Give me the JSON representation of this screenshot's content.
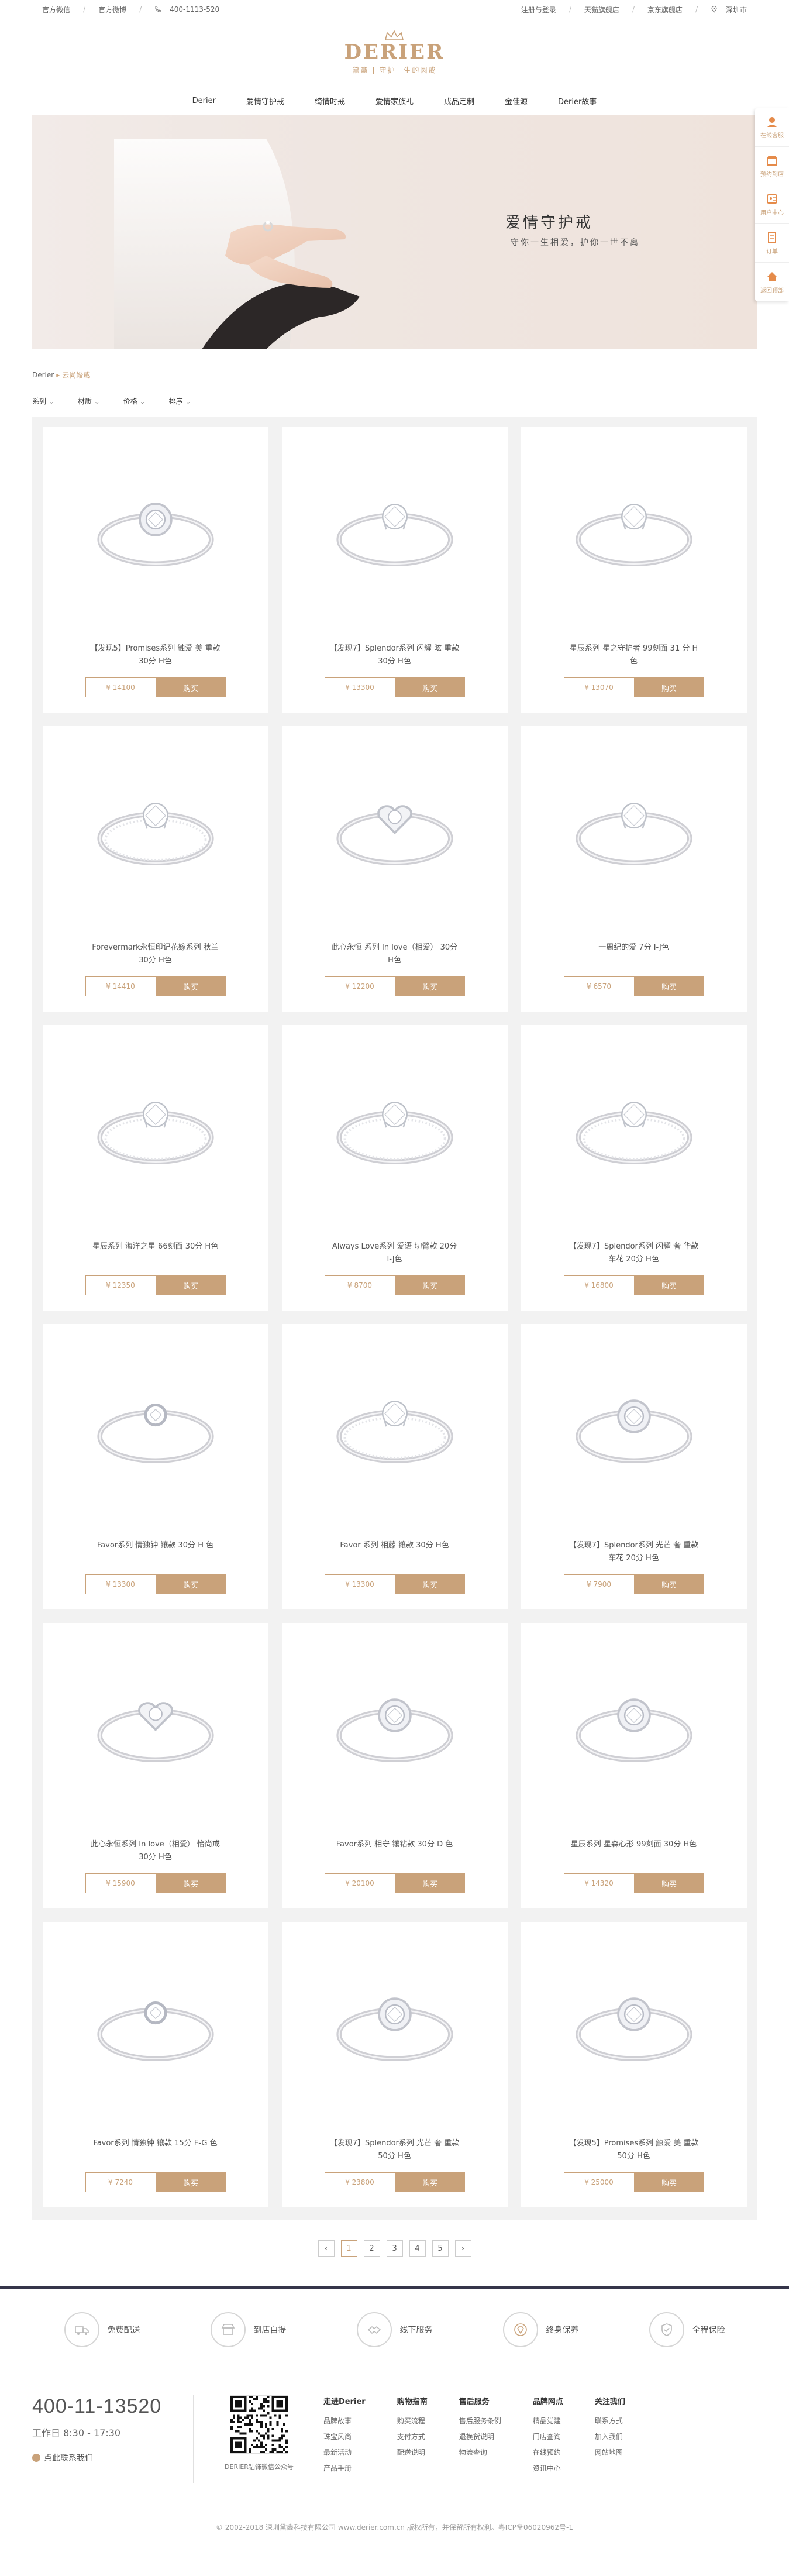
{
  "topbar": {
    "left": [
      "官方微信",
      "官方微博",
      "400-1113-520"
    ],
    "right": [
      "注册与登录",
      "天猫旗舰店",
      "京东旗舰店",
      "深圳市"
    ]
  },
  "logo": {
    "brand": "DERIER",
    "slogan": "黛鑫 | 守护一生的圆戒"
  },
  "nav": [
    "Derier",
    "爱情守护戒",
    "绮情时戒",
    "爱情家族礼",
    "成品定制",
    "金佳源",
    "Derier故事"
  ],
  "banner": {
    "title": "爱情守护戒",
    "subtitle": "守你一生相爱，护你一世不离"
  },
  "float_bar": [
    "在线客服",
    "预约到店",
    "用户中心",
    "订单",
    "返回顶部"
  ],
  "breadcrumb": {
    "root": "Derier",
    "current": "云尚婚戒"
  },
  "filters": [
    "系列",
    "材质",
    "价格",
    "排序"
  ],
  "buy_label": "购买",
  "products": [
    {
      "name": "【发现5】Promises系列 触爱 美 重款 30分 H色",
      "price": "¥ 14100"
    },
    {
      "name": "【发现7】Splendor系列 闪耀 眩 重款 30分 H色",
      "price": "¥ 13300"
    },
    {
      "name": "星辰系列 星之守护者 99刻面 31 分 H色",
      "price": "¥ 13070"
    },
    {
      "name": "Forevermark永恒印记花嫁系列 秋兰 30分 H色",
      "price": "¥ 14410"
    },
    {
      "name": "此心永恒 系列 In love（相爱） 30分 H色",
      "price": "¥ 12200"
    },
    {
      "name": "一周纪的爱 7分 I-J色",
      "price": "¥ 6570"
    },
    {
      "name": "星辰系列 海洋之星 66刻面 30分 H色",
      "price": "¥ 12350"
    },
    {
      "name": "Always Love系列 爱语 切臂款 20分 I-J色",
      "price": "¥ 8700"
    },
    {
      "name": "【发现7】Splendor系列 闪耀 奢 华款 车花 20分 H色",
      "price": "¥ 16800"
    },
    {
      "name": "Favor系列 情独钟 镶款 30分 H 色",
      "price": "¥ 13300"
    },
    {
      "name": "Favor 系列 相藤 镶款 30分 H色",
      "price": "¥ 13300"
    },
    {
      "name": "【发现7】Splendor系列 光芒 奢 重款 车花 20分 H色",
      "price": "¥ 7900"
    },
    {
      "name": "此心永恒系列 In love（相爱） 怡尚戒 30分 H色",
      "price": "¥ 15900"
    },
    {
      "name": "Favor系列 相守 镶钻款 30分 D 色",
      "price": "¥ 20100"
    },
    {
      "name": "星辰系列 星森心形 99刻面 30分 H色",
      "price": "¥ 14320"
    },
    {
      "name": "Favor系列 情独钟 镶款 15分 F-G 色",
      "price": "¥ 7240"
    },
    {
      "name": "【发现7】Splendor系列 光芒 奢 重款 50分 H色",
      "price": "¥ 23800"
    },
    {
      "name": "【发现5】Promises系列 触爱 美 重款 50分 H色",
      "price": "¥ 25000"
    }
  ],
  "pager": {
    "prev": "‹",
    "pages": [
      "1",
      "2",
      "3",
      "4",
      "5"
    ],
    "next": "›",
    "active": "1"
  },
  "services": [
    "免费配送",
    "到店自提",
    "线下服务",
    "终身保养",
    "全程保险"
  ],
  "contact": {
    "phone": "400-11-13520",
    "time": "工作日 8:30 - 17:30",
    "online": "点此联系我们"
  },
  "qr_label": "DERIER钻饰微信公众号",
  "footer_cols": [
    {
      "title": "走进Derier",
      "items": [
        "品牌故事",
        "珠宝风尚",
        "最新活动",
        "产品手册"
      ]
    },
    {
      "title": "购物指南",
      "items": [
        "购买流程",
        "支付方式",
        "配送说明"
      ]
    },
    {
      "title": "售后服务",
      "items": [
        "售后服务条例",
        "退换货说明",
        "物流查询"
      ]
    },
    {
      "title": "品牌网点",
      "items": [
        "精品党建",
        "门店查询",
        "在线预约",
        "资讯中心"
      ]
    },
    {
      "title": "关注我们",
      "items": [
        "联系方式",
        "加入我们",
        "网站地图"
      ]
    }
  ],
  "copyright": "© 2002-2018 深圳黛鑫科技有限公司 www.derier.com.cn 版权所有，并保留所有权利。粤ICP备06020962号-1",
  "colors": {
    "accent": "#c9a27a",
    "footer_band": "#35354a",
    "grid_bg": "#f2f2f2"
  }
}
